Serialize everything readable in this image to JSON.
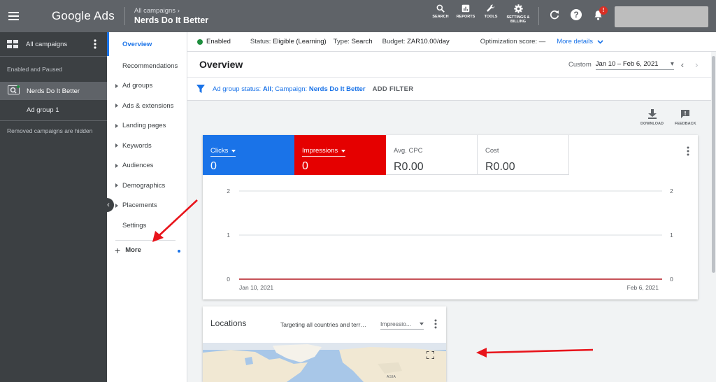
{
  "topbar": {
    "logo": "Google Ads",
    "breadcrumb_parent": "All campaigns",
    "breadcrumb_current": "Nerds Do It Better",
    "icons": [
      {
        "name": "search-icon",
        "label": "SEARCH"
      },
      {
        "name": "reports-icon",
        "label": "REPORTS"
      },
      {
        "name": "tools-icon",
        "label": "TOOLS"
      },
      {
        "name": "settings-icon",
        "label": "SETTINGS & BILLING"
      }
    ],
    "notification_count": "!"
  },
  "leftpanel": {
    "all_campaigns": "All campaigns",
    "section_label": "Enabled and Paused",
    "campaign": "Nerds Do It Better",
    "ad_group": "Ad group 1",
    "removed_note": "Removed campaigns are hidden"
  },
  "pagemenu": {
    "items": [
      {
        "label": "Overview",
        "active": true,
        "expandable": false
      },
      {
        "label": "Recommendations",
        "active": false,
        "expandable": false
      },
      {
        "label": "Ad groups",
        "active": false,
        "expandable": true
      },
      {
        "label": "Ads & extensions",
        "active": false,
        "expandable": true
      },
      {
        "label": "Landing pages",
        "active": false,
        "expandable": true
      },
      {
        "label": "Keywords",
        "active": false,
        "expandable": true
      },
      {
        "label": "Audiences",
        "active": false,
        "expandable": true
      },
      {
        "label": "Demographics",
        "active": false,
        "expandable": true
      },
      {
        "label": "Placements",
        "active": false,
        "expandable": true
      },
      {
        "label": "Settings",
        "active": false,
        "expandable": false
      }
    ],
    "more_label": "More"
  },
  "statusbar": {
    "state": "Enabled",
    "status_label": "Status:",
    "status_value": "Eligible (Learning)",
    "type_label": "Type:",
    "type_value": "Search",
    "budget_label": "Budget:",
    "budget_value": "ZAR10.00/day",
    "opt_label": "Optimization score:",
    "opt_value": "—",
    "more_details": "More details",
    "colors": {
      "enabled": "#1e8e3e",
      "link": "#1a73e8"
    }
  },
  "overview": {
    "title": "Overview",
    "date_label": "Custom",
    "date_value": "Jan 10 – Feb 6, 2021"
  },
  "filter": {
    "prefix": "Ad group status: ",
    "status_value": "All",
    "middle": "; Campaign: ",
    "campaign_value": "Nerds Do It Better",
    "add_filter": "ADD FILTER"
  },
  "actions": {
    "download": "DOWNLOAD",
    "feedback": "FEEDBACK"
  },
  "metrics": [
    {
      "label": "Clicks",
      "value": "0",
      "color": "#1a73e8",
      "selectable": true
    },
    {
      "label": "Impressions",
      "value": "0",
      "color": "#e50000",
      "selectable": true
    },
    {
      "label": "Avg. CPC",
      "value": "R0.00",
      "color": null,
      "selectable": false
    },
    {
      "label": "Cost",
      "value": "R0.00",
      "color": null,
      "selectable": false
    }
  ],
  "chart_data": {
    "type": "line",
    "x": [
      "Jan 10, 2021",
      "Feb 6, 2021"
    ],
    "x_tick_labels": [
      "Jan 10, 2021",
      "Feb 6, 2021"
    ],
    "series": [
      {
        "name": "Clicks",
        "values": [
          0,
          0
        ],
        "color": "#1a73e8"
      },
      {
        "name": "Impressions",
        "values": [
          0,
          0
        ],
        "color": "#d93025"
      }
    ],
    "ylim_left": [
      0,
      2
    ],
    "ylim_right": [
      0,
      2
    ],
    "y_ticks_left": [
      0,
      1,
      2
    ],
    "y_ticks_right": [
      0,
      1,
      2
    ],
    "grid": true,
    "legend": "none"
  },
  "locations": {
    "title": "Locations",
    "targeting": "Targeting all countries and territories",
    "metric_select": "Impressions",
    "map_label": "ASIA"
  }
}
